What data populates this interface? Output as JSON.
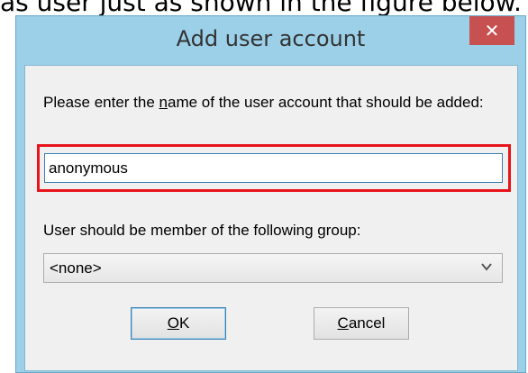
{
  "document": {
    "caption_fragment": "as user just as shown in the figure below."
  },
  "window": {
    "title": "Add user account",
    "close_glyph": "✕"
  },
  "prompt": {
    "text_before_access": "Please enter the ",
    "access_char": "n",
    "text_after_access": "ame of the user account that should be added:"
  },
  "name_field": {
    "value": "anonymous"
  },
  "group": {
    "label_before_access": "User should be member of the following ",
    "access_char": "g",
    "label_after_access": "roup:",
    "selected": "<none>"
  },
  "buttons": {
    "ok_access": "O",
    "ok_rest": "K",
    "cancel_access": "C",
    "cancel_rest": "ancel"
  },
  "colors": {
    "title_bar": "#9bd0e8",
    "close_button": "#c75050",
    "highlight_border": "#e8141c",
    "client_bg": "#f0f0f0"
  },
  "icons": {
    "close": "close-icon",
    "dropdown": "chevron-down-icon"
  }
}
